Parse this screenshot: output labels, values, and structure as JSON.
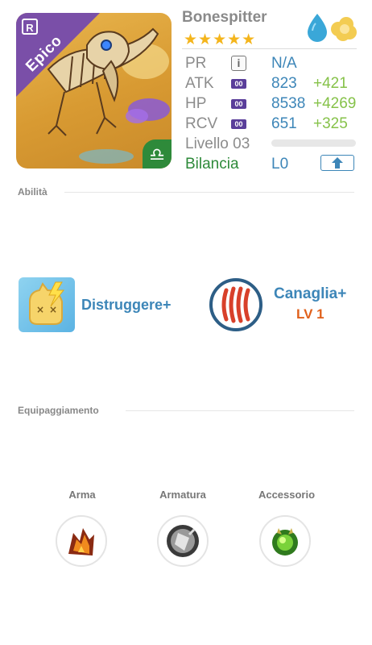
{
  "hero": {
    "name": "Bonespitter",
    "rarity": "Epico",
    "rank_badge": "R",
    "stars": "★★★★★",
    "element_icons": [
      "water-drop-icon",
      "cloud-icon"
    ]
  },
  "stats": {
    "pr": {
      "label": "PR",
      "value": "N/A"
    },
    "atk": {
      "label": "ATK",
      "boost": "00",
      "value": "823",
      "bonus": "+421"
    },
    "hp": {
      "label": "HP",
      "boost": "00",
      "value": "8538",
      "bonus": "+4269"
    },
    "rcv": {
      "label": "RCV",
      "boost": "00",
      "value": "651",
      "bonus": "+325"
    },
    "level": {
      "label": "Livello 03",
      "progress": 0
    },
    "balance": {
      "label": "Bilancia",
      "value": "L0"
    }
  },
  "abilities": {
    "title": "Abilità",
    "skill1": {
      "name": "Distruggere+"
    },
    "skill2": {
      "name": "Canaglia+",
      "level": "LV 1"
    }
  },
  "equipment": {
    "title": "Equipaggiamento",
    "slots": [
      {
        "label": "Arma"
      },
      {
        "label": "Armatura"
      },
      {
        "label": "Accessorio"
      }
    ]
  },
  "colors": {
    "accent_blue": "#3d86b8",
    "bonus_green": "#86c24a",
    "rarity_purple": "#7a4fa8",
    "star_gold": "#f4b51c",
    "level_orange": "#e0611c",
    "balance_green": "#2e8a3a"
  }
}
